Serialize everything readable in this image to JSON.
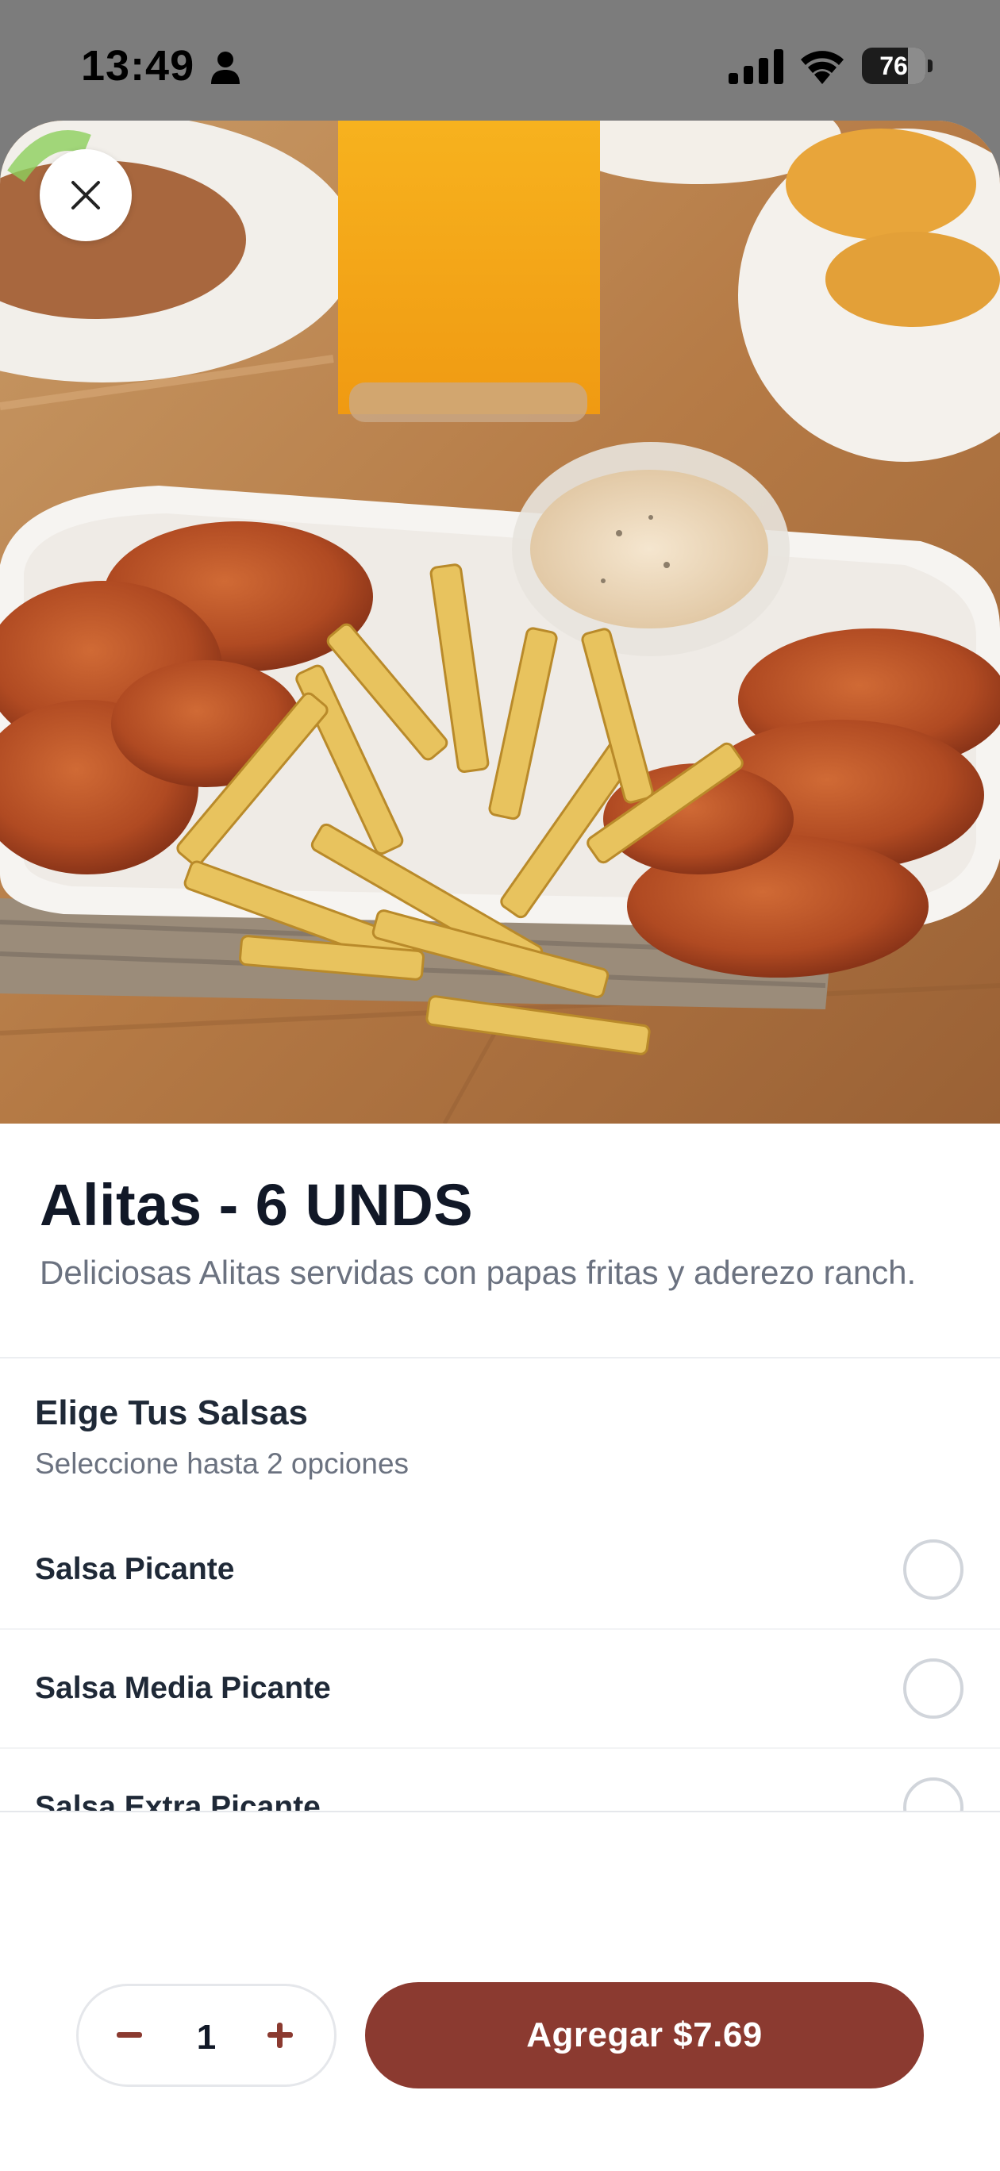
{
  "status_bar": {
    "time": "13:49",
    "battery": "76",
    "icons": [
      "person-icon",
      "signal-icon",
      "wifi-icon",
      "battery-icon"
    ]
  },
  "product": {
    "title": "Alitas - 6 UNDS",
    "description": "Deliciosas Alitas servidas con papas fritas y aderezo ranch."
  },
  "options_section": {
    "title": "Elige Tus Salsas",
    "subtitle": "Seleccione hasta 2 opciones",
    "items": [
      {
        "label": "Salsa Picante",
        "selected": false
      },
      {
        "label": "Salsa Media Picante",
        "selected": false
      },
      {
        "label": "Salsa Extra Picante",
        "selected": false
      }
    ]
  },
  "footer": {
    "quantity": "1",
    "add_label": "Agregar $7.69"
  },
  "colors": {
    "accent": "#8b3a30",
    "title": "#111827",
    "muted": "#6b7280"
  }
}
